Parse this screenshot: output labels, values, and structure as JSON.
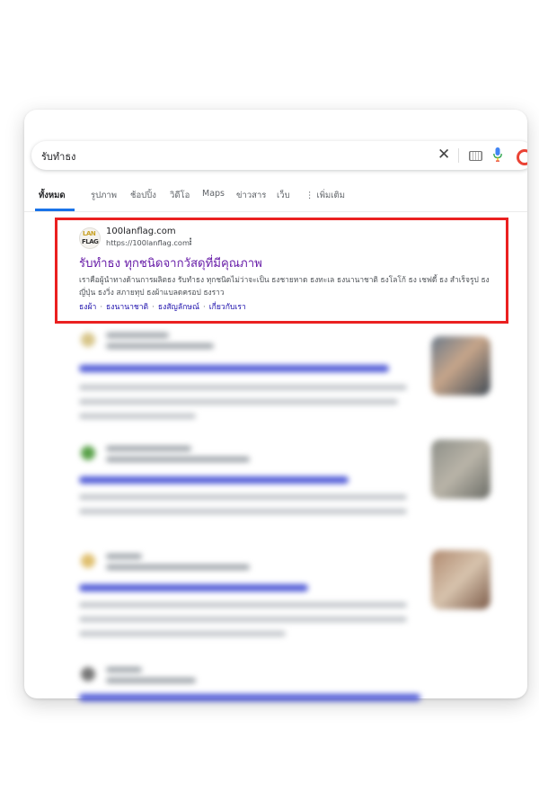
{
  "search": {
    "query": "รับทำธง"
  },
  "tabs": [
    "ทั้งหมด",
    "รูปภาพ",
    "ช้อปปิ้ง",
    "วิดีโอ",
    "Maps",
    "ข่าวสาร",
    "เว็บ",
    "เพิ่มเติม"
  ],
  "result": {
    "favicon_text_top": "LAN",
    "favicon_text_bottom": "FLAG",
    "site_name": "100lanflag.com",
    "url": "https://100lanflag.com",
    "title": "รับทำธง ทุกชนิดจากวัสดุที่มีคุณภาพ",
    "snippet": "เราคือผู้นำทางด้านการผลิตธง รับทำธง ทุกชนิดไม่ว่าจะเป็น ธงชายหาด ธงทะเล ธงนานาชาติ ธงโลโก้ ธง เชฟดี้ ธง สำเร็จรูป ธงญี่ปุ่น ธงวิ่ง สภายทุป ธงผ้าแบลดครอป ธงราว",
    "sitelinks": [
      "ธงผ้า",
      "ธงนานาชาติ",
      "ธงสัญลักษณ์",
      "เกี่ยวกับเรา"
    ]
  },
  "colors": {
    "highlight": "#ea2020",
    "link_visited": "#681da8",
    "link": "#1a0dab"
  }
}
